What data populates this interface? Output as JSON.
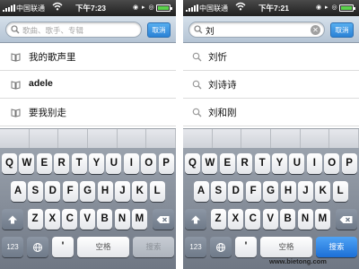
{
  "left": {
    "status": {
      "carrier": "中国联通",
      "time": "下午7:23"
    },
    "search": {
      "placeholder": "歌曲、歌手、专辑",
      "value": "",
      "cancel_label": "取消"
    },
    "history": [
      {
        "label": "我的歌声里",
        "icon": "book-icon"
      },
      {
        "label": "adele",
        "icon": "book-icon"
      },
      {
        "label": "要我别走",
        "icon": "book-icon"
      }
    ],
    "keyboard": {
      "search_label": "搜索",
      "search_active": false
    }
  },
  "right": {
    "status": {
      "carrier": "中国联通",
      "time": "下午7:21"
    },
    "search": {
      "placeholder": "",
      "value": "刘",
      "cancel_label": "取消"
    },
    "suggestions": [
      {
        "label": "刘忻",
        "icon": "search-icon"
      },
      {
        "label": "刘诗诗",
        "icon": "search-icon"
      },
      {
        "label": "刘和刚",
        "icon": "search-icon"
      }
    ],
    "keyboard": {
      "search_label": "搜索",
      "search_active": true
    }
  },
  "keyboard_common": {
    "row1": [
      "Q",
      "W",
      "E",
      "R",
      "T",
      "Y",
      "U",
      "I",
      "O",
      "P"
    ],
    "row2": [
      "A",
      "S",
      "D",
      "F",
      "G",
      "H",
      "J",
      "K",
      "L"
    ],
    "row3": [
      "Z",
      "X",
      "C",
      "V",
      "B",
      "N",
      "M"
    ],
    "numbers_label": "123",
    "apostrophe_label": "'",
    "space_label": "空格",
    "globe_icon": "globe-icon",
    "shift_icon": "shift-icon",
    "delete_icon": "delete-icon"
  },
  "watermark": "www.bietong.com",
  "colors": {
    "accent_blue": "#2b82d6",
    "statusbar": "#1f1f1f",
    "searchbar": "#c6d3e0"
  }
}
